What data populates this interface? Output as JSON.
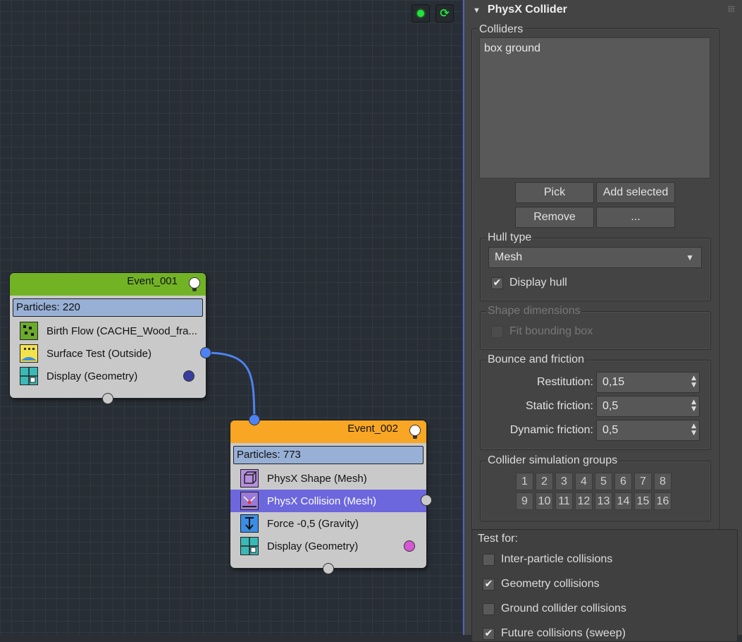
{
  "canvas": {
    "toolbar": {
      "status_icon": "green-dot-icon",
      "refresh_icon": "refresh-cycle-icon"
    },
    "events": [
      {
        "title": "Event_001",
        "header_color": "#72b326",
        "particles": "Particles: 220",
        "operators": [
          {
            "label": "Birth Flow (CACHE_Wood_fra...",
            "icon": "birth-flow-icon",
            "selected": false
          },
          {
            "label": "Surface Test (Outside)",
            "icon": "surface-test-icon",
            "selected": false
          },
          {
            "label": "Display (Geometry)",
            "icon": "display-icon",
            "selected": false,
            "display_color": "#3a3d9e"
          }
        ]
      },
      {
        "title": "Event_002",
        "header_color": "#f8a623",
        "particles": "Particles: 773",
        "operators": [
          {
            "label": "PhysX Shape (Mesh)",
            "icon": "physx-shape-icon",
            "selected": false
          },
          {
            "label": "PhysX Collision (Mesh)",
            "icon": "physx-collision-icon",
            "selected": true
          },
          {
            "label": "Force -0,5 (Gravity)",
            "icon": "force-icon",
            "selected": false
          },
          {
            "label": "Display (Geometry)",
            "icon": "display-icon",
            "selected": false,
            "display_color": "#d657d6"
          }
        ]
      }
    ],
    "wire_color": "#4d82f2"
  },
  "panel": {
    "title": "PhysX Collider",
    "colliders": {
      "label": "Colliders",
      "items": [
        "box ground"
      ],
      "pick": "Pick",
      "add_selected": "Add selected",
      "remove": "Remove",
      "more": "..."
    },
    "hull": {
      "label": "Hull type",
      "value": "Mesh",
      "display_hull": "Display hull",
      "display_hull_checked": true
    },
    "shape": {
      "label": "Shape dimensions",
      "fit_bounding_box": "Fit bounding box"
    },
    "bounce": {
      "label": "Bounce and friction",
      "restitution_label": "Restitution:",
      "restitution": "0,15",
      "static_label": "Static friction:",
      "static": "0,5",
      "dynamic_label": "Dynamic friction:",
      "dynamic": "0,5"
    },
    "groups": {
      "label": "Collider simulation groups",
      "numbers": [
        "1",
        "2",
        "3",
        "4",
        "5",
        "6",
        "7",
        "8",
        "9",
        "10",
        "11",
        "12",
        "13",
        "14",
        "15",
        "16"
      ]
    },
    "test_for": {
      "label": "Test for:",
      "options": [
        {
          "label": "Inter-particle collisions",
          "checked": false
        },
        {
          "label": "Geometry collisions",
          "checked": true
        },
        {
          "label": "Ground collider collisions",
          "checked": false
        },
        {
          "label": "Future collisions (sweep)",
          "checked": true
        }
      ]
    }
  }
}
